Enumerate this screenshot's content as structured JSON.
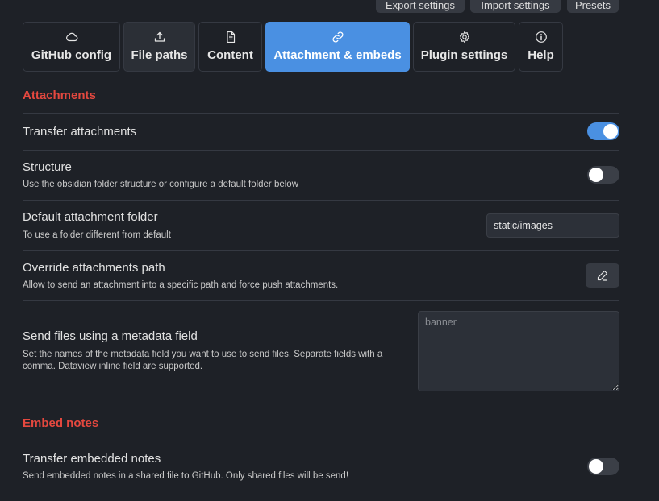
{
  "top_buttons": [
    {
      "label": "Export settings"
    },
    {
      "label": "Import settings"
    },
    {
      "label": "Presets"
    }
  ],
  "tabs": [
    {
      "label": "GitHub config",
      "icon": "cloud-icon"
    },
    {
      "label": "File paths",
      "icon": "upload-icon"
    },
    {
      "label": "Content",
      "icon": "file-text-icon"
    },
    {
      "label": "Attachment & embeds",
      "icon": "link-icon"
    },
    {
      "label": "Plugin settings",
      "icon": "gear-icon"
    },
    {
      "label": "Help",
      "icon": "info-icon"
    }
  ],
  "active_tab": "Attachment & embeds",
  "sections": {
    "attachments": {
      "title": "Attachments",
      "items": [
        {
          "name": "Transfer attachments",
          "desc": "",
          "toggle": true
        },
        {
          "name": "Structure",
          "desc": "Use the obsidian folder structure or configure a default folder below",
          "toggle": false
        },
        {
          "name": "Default attachment folder",
          "desc": "To use a folder different from default",
          "value": "static/images"
        },
        {
          "name": "Override attachments path",
          "desc": "Allow to send an attachment into a specific path and force push attachments."
        },
        {
          "name": "Send files using a metadata field",
          "desc": "Set the names of the metadata field you want to use to send files. Separate fields with a comma. Dataview inline field are supported.",
          "placeholder": "banner"
        }
      ]
    },
    "embed": {
      "title": "Embed notes",
      "items": [
        {
          "name": "Transfer embedded notes",
          "desc": "Send embedded notes in a shared file to GitHub. Only shared files will be send!",
          "toggle": false
        }
      ]
    }
  },
  "colors": {
    "accent": "#4a90e2",
    "section_title": "#e4483f",
    "background": "#1e2127"
  }
}
